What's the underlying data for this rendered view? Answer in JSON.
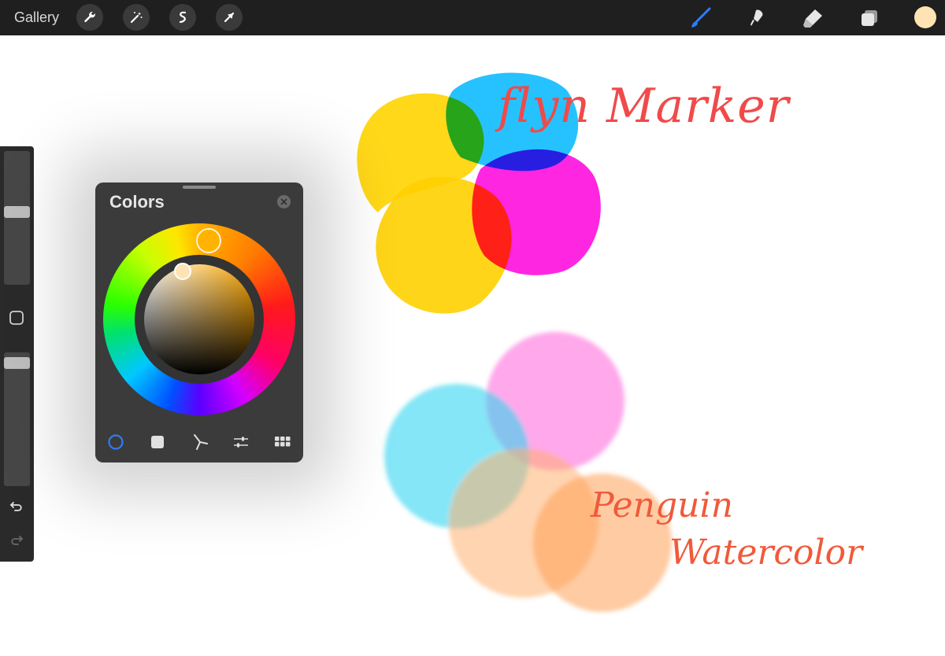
{
  "topbar": {
    "gallery_label": "Gallery",
    "left_tools": [
      "wrench-icon",
      "magic-wand-icon",
      "selection-icon",
      "transform-arrow-icon"
    ],
    "right_tools": [
      "brush-icon",
      "smudge-icon",
      "eraser-icon",
      "layers-icon"
    ],
    "active_tool": "brush-icon",
    "active_color": "#ffe3b3",
    "accent": "#2f7cf6"
  },
  "sidebar": {
    "brush_size": 0.55,
    "opacity": 0.96,
    "icons": [
      "modify-square-icon",
      "undo-icon",
      "redo-icon"
    ]
  },
  "colors_panel": {
    "title": "Colors",
    "modes": [
      "disc-mode-icon",
      "classic-mode-icon",
      "harmony-mode-icon",
      "value-mode-icon",
      "palettes-mode-icon"
    ],
    "selected_mode": "disc-mode-icon",
    "current_color": "#ffe3b3"
  },
  "canvas": {
    "marker_label": "flyn Marker",
    "watercolor_label_1": "Penguin",
    "watercolor_label_2": "Watercolor"
  }
}
